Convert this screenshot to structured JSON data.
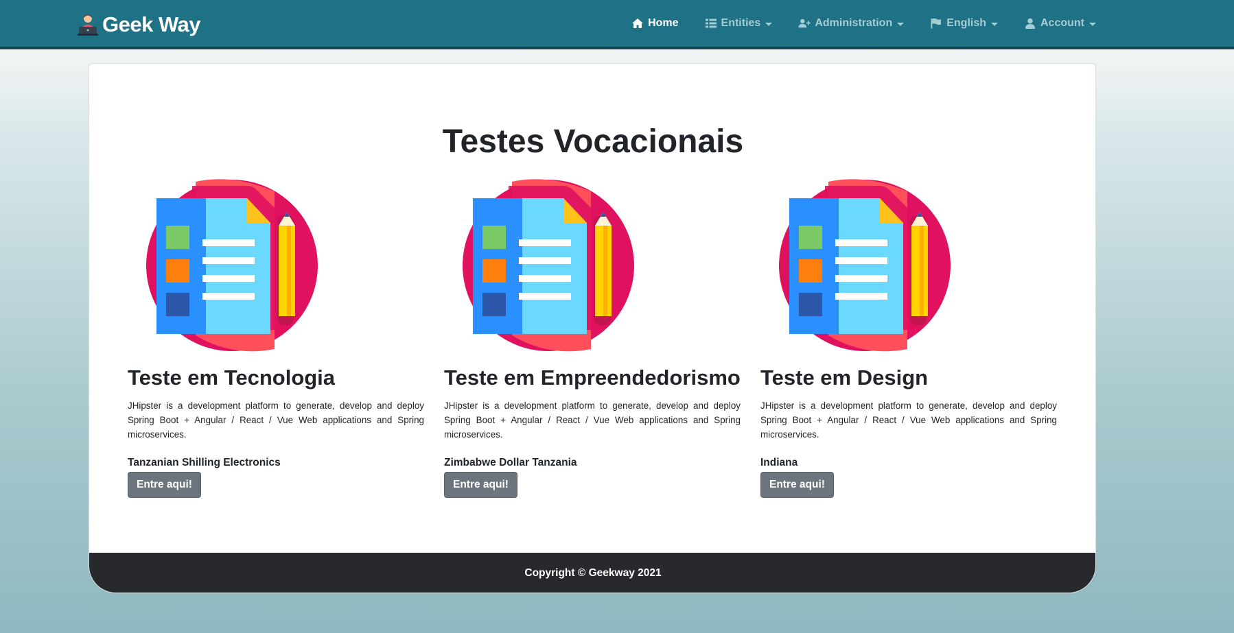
{
  "brand": {
    "name": "Geek Way",
    "logo_icon": "developer-avatar-icon"
  },
  "nav": {
    "items": [
      {
        "label": "Home",
        "icon": "home-icon",
        "active": true,
        "dropdown": false
      },
      {
        "label": "Entities",
        "icon": "table-list-icon",
        "active": false,
        "dropdown": true
      },
      {
        "label": "Administration",
        "icon": "user-plus-icon",
        "active": false,
        "dropdown": true
      },
      {
        "label": "English",
        "icon": "flag-icon",
        "active": false,
        "dropdown": true
      },
      {
        "label": "Account",
        "icon": "user-icon",
        "active": false,
        "dropdown": true
      }
    ]
  },
  "main": {
    "title": "Testes Vocacionais",
    "tests": [
      {
        "title": "Teste em Tecnologia",
        "description": "JHipster is a development platform to generate, develop and deploy Spring Boot + Angular / React / Vue Web applications and Spring microservices.",
        "tags": "Tanzanian Shilling Electronics",
        "button_label": "Entre aqui!",
        "illustration_icon": "test-document-pencil-icon"
      },
      {
        "title": "Teste em Empreendedorismo",
        "description": "JHipster is a development platform to generate, develop and deploy Spring Boot + Angular / React / Vue Web applications and Spring microservices.",
        "tags": "Zimbabwe Dollar Tanzania",
        "button_label": "Entre aqui!",
        "illustration_icon": "test-document-pencil-icon"
      },
      {
        "title": "Teste em Design",
        "description": "JHipster is a development platform to generate, develop and deploy Spring Boot + Angular / React / Vue Web applications and Spring microservices.",
        "tags": "Indiana",
        "button_label": "Entre aqui!",
        "illustration_icon": "test-document-pencil-icon"
      }
    ]
  },
  "footer": {
    "copyright": "Copyright © Geekway 2021"
  },
  "colors": {
    "navbar": "#1f7285",
    "nav_inactive_text": "#a6ccd5",
    "button": "#6c757d",
    "footer": "#27292d"
  }
}
